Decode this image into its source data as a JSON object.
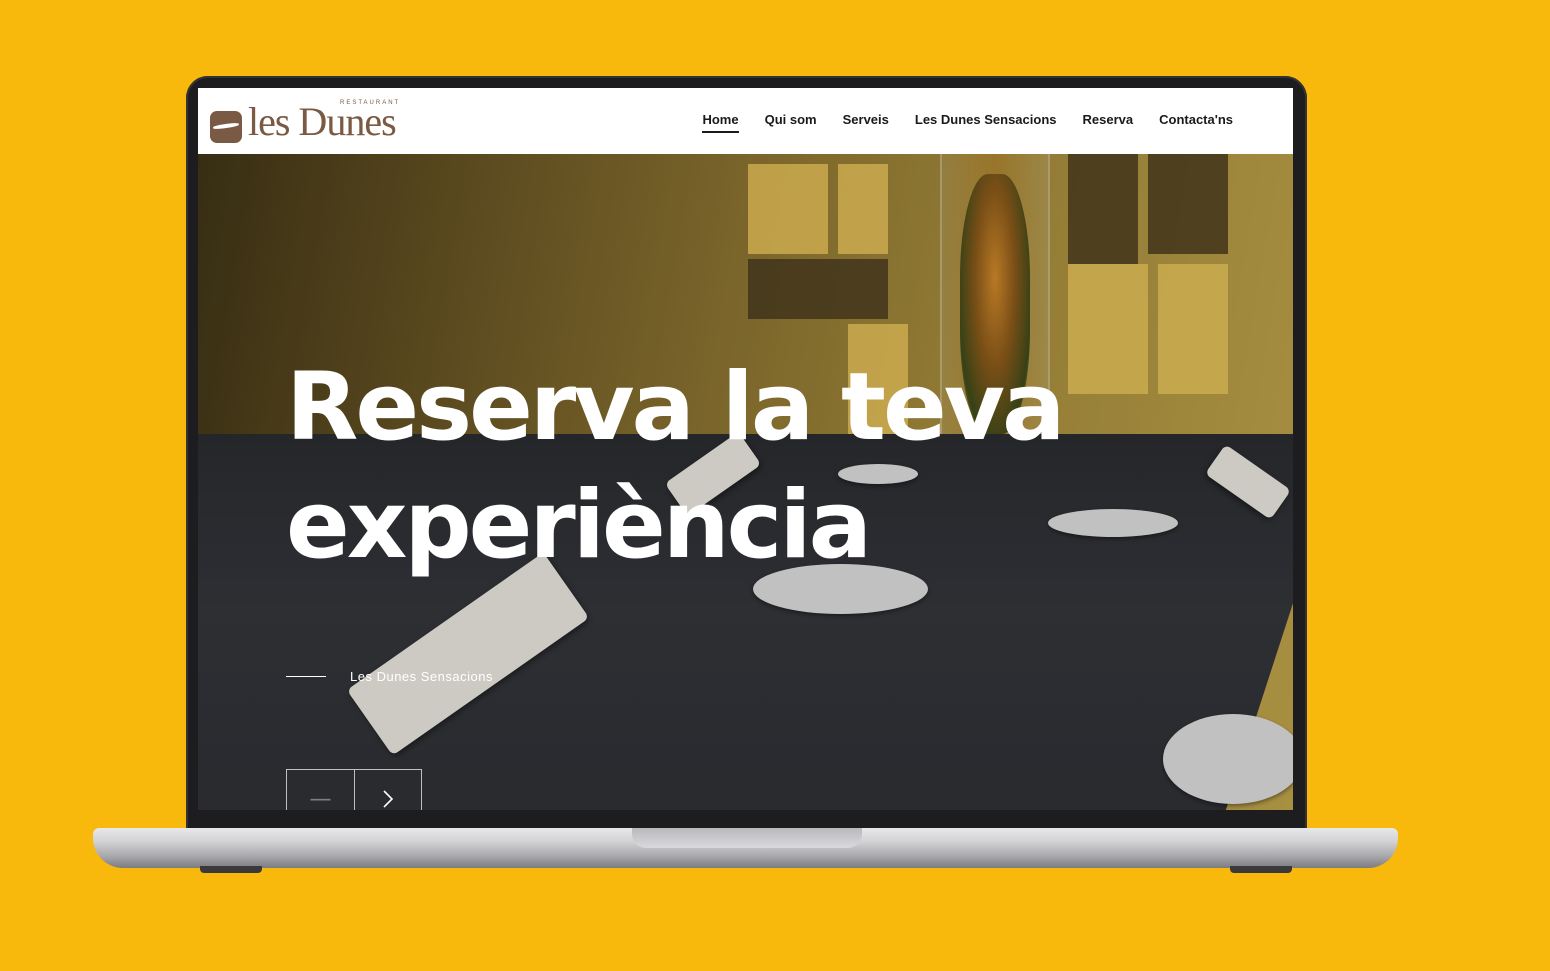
{
  "logo": {
    "text": "les Dunes",
    "tagline": "RESTAURANT"
  },
  "nav": {
    "items": [
      {
        "label": "Home",
        "active": true
      },
      {
        "label": "Qui som",
        "active": false
      },
      {
        "label": "Serveis",
        "active": false
      },
      {
        "label": "Les Dunes Sensacions",
        "active": false
      },
      {
        "label": "Reserva",
        "active": false
      },
      {
        "label": "Contacta'ns",
        "active": false
      }
    ]
  },
  "hero": {
    "title_line1": "Reserva la teva",
    "title_line2": "experiència",
    "subtitle": "Les Dunes Sensacions",
    "prev_icon": "minus-icon",
    "next_icon": "chevron-right-icon"
  },
  "colors": {
    "background": "#F9B90C",
    "brand": "#7a5a44",
    "hero_text": "#ffffff"
  }
}
